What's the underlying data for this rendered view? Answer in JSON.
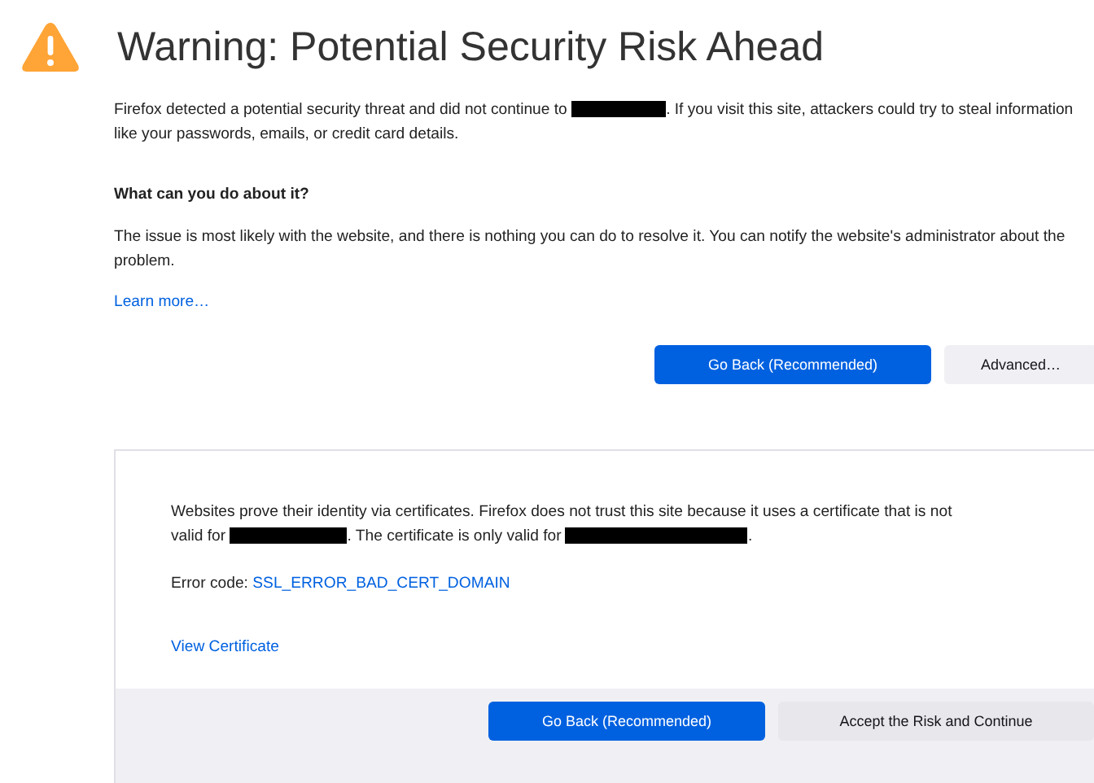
{
  "title": "Warning: Potential Security Risk Ahead",
  "intro": [
    {
      "kind": "text",
      "text": "Firefox detected a potential security threat and did not continue to "
    },
    {
      "kind": "redacted_short"
    },
    {
      "kind": "text",
      "text": ". If you visit this site, attackers could try to steal information like your passwords, emails, or credit card details."
    }
  ],
  "heading": "What can you do about it?",
  "advice": "The issue is most likely with the website, and there is nothing you can do to resolve it. You can notify the website's administrator about the problem.",
  "learn_more": "Learn more…",
  "buttons": [
    {
      "label": "Go Back (Recommended)",
      "kind": "primary"
    },
    {
      "label": "Advanced…",
      "kind": "secondary"
    }
  ],
  "advanced": {
    "explanation": [
      {
        "kind": "text",
        "text": "Websites prove their identity via certificates. Firefox does not trust this site because it uses a certificate that is not valid for "
      },
      {
        "kind": "redacted_medium"
      },
      {
        "kind": "text",
        "text": ". The certificate is only valid for "
      },
      {
        "kind": "redacted_long"
      },
      {
        "kind": "text",
        "text": "."
      }
    ],
    "error_label": "Error code:",
    "error_code": "SSL_ERROR_BAD_CERT_DOMAIN",
    "view_certificate": "View Certificate",
    "buttons": [
      {
        "label": "Go Back (Recommended)",
        "kind": "primary"
      },
      {
        "label": "Accept the Risk and Continue",
        "kind": "secondary"
      }
    ]
  }
}
